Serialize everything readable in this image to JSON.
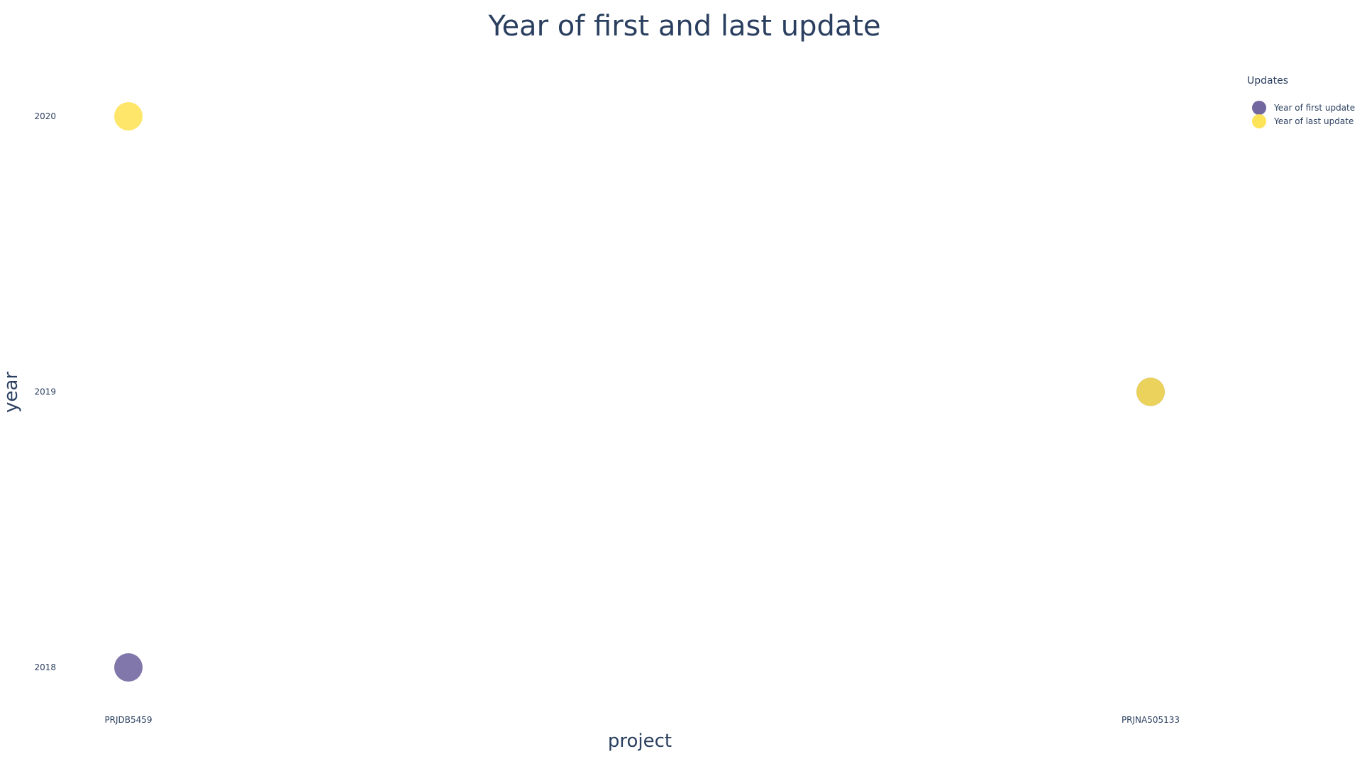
{
  "chart_data": {
    "type": "scatter",
    "title": "Year of first and last update",
    "xlabel": "project",
    "ylabel": "year",
    "categories": [
      "PRJDB5459",
      "PRJNA505133"
    ],
    "y_ticks": [
      "2018",
      "2019",
      "2020"
    ],
    "ylim": [
      2018,
      2020
    ],
    "grid": false,
    "legend": {
      "title": "Updates",
      "placement": "top-right",
      "entries": [
        {
          "label": "Year of first update",
          "color": "#6c5f9b"
        },
        {
          "label": "Year of last update",
          "color": "#fde24f"
        }
      ]
    },
    "points": [
      {
        "x": "PRJDB5459",
        "y": 2018,
        "series": "Year of first update",
        "color": "#6c5f9b"
      },
      {
        "x": "PRJDB5459",
        "y": 2020,
        "series": "Year of last update",
        "color": "#fde24f"
      },
      {
        "x": "PRJNA505133",
        "y": 2019,
        "series": "Year of first update",
        "color": "#6c5f9b"
      },
      {
        "x": "PRJNA505133",
        "y": 2019,
        "series": "Year of last update",
        "color": "#fde24f"
      }
    ]
  }
}
